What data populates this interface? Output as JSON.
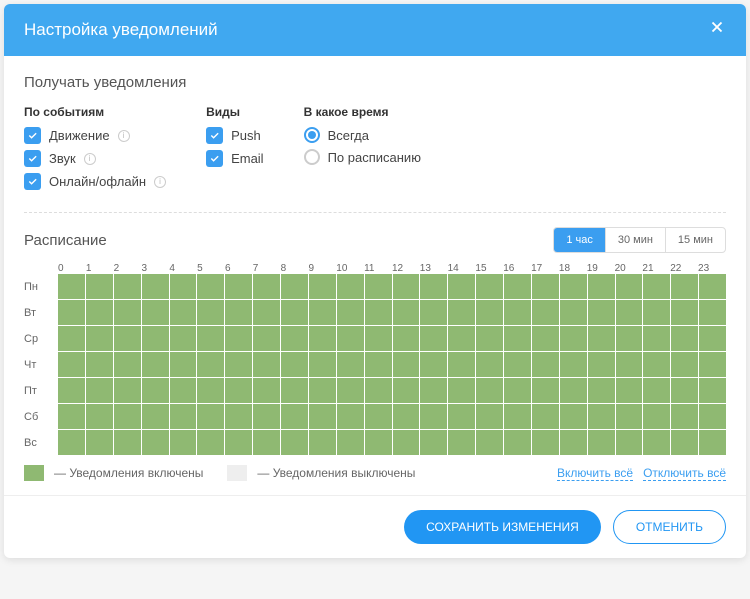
{
  "header": {
    "title": "Настройка уведомлений"
  },
  "section_title": "Получать уведомления",
  "filters": {
    "events": {
      "title": "По событиям",
      "items": [
        "Движение",
        "Звук",
        "Онлайн/офлайн"
      ]
    },
    "types": {
      "title": "Виды",
      "items": [
        "Push",
        "Email"
      ]
    },
    "time": {
      "title": "В какое время",
      "items": [
        "Всегда",
        "По расписанию"
      ],
      "selected": 0
    }
  },
  "schedule": {
    "title": "Расписание",
    "intervals": [
      "1 час",
      "30 мин",
      "15 мин"
    ],
    "interval_active": 0,
    "hours": [
      "0",
      "1",
      "2",
      "3",
      "4",
      "5",
      "6",
      "7",
      "8",
      "9",
      "10",
      "11",
      "12",
      "13",
      "14",
      "15",
      "16",
      "17",
      "18",
      "19",
      "20",
      "21",
      "22",
      "23"
    ],
    "days": [
      "Пн",
      "Вт",
      "Ср",
      "Чт",
      "Пт",
      "Сб",
      "Вс"
    ]
  },
  "legend": {
    "on": "— Уведомления включены",
    "off": "— Уведомления выключены"
  },
  "actions": {
    "enable_all": "Включить всё",
    "disable_all": "Отключить всё"
  },
  "footer": {
    "save": "СОХРАНИТЬ ИЗМЕНЕНИЯ",
    "cancel": "ОТМЕНИТЬ"
  }
}
